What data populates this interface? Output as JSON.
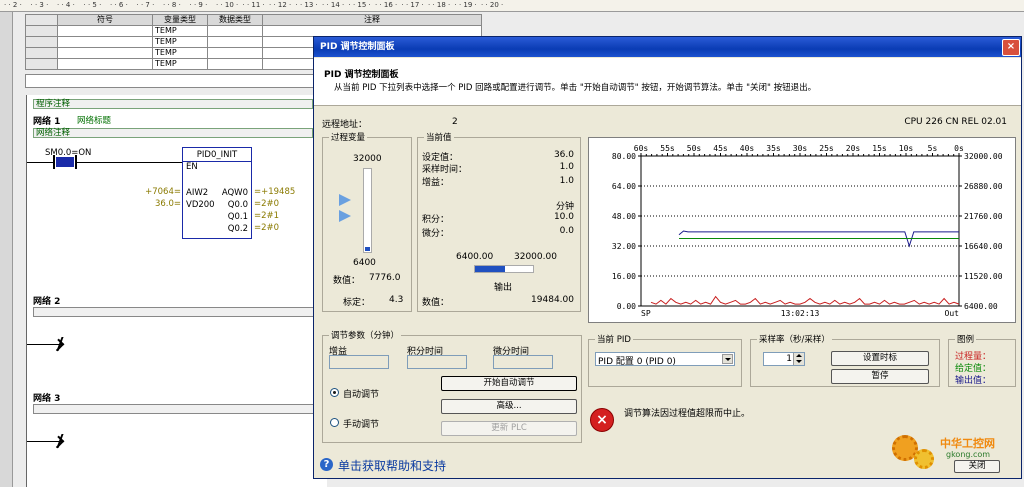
{
  "ruler": {
    "ticks": [
      "2",
      "3",
      "4",
      "5",
      "6",
      "7",
      "8",
      "9",
      "10",
      "11",
      "12",
      "13",
      "14",
      "15",
      "16",
      "17",
      "18",
      "19",
      "20"
    ]
  },
  "var_table": {
    "headers": [
      "符号",
      "变量类型",
      "数据类型",
      "注释"
    ],
    "rows": [
      [
        "TEMP"
      ],
      [
        "TEMP"
      ],
      [
        "TEMP"
      ],
      [
        "TEMP"
      ]
    ]
  },
  "ladder": {
    "program_comment": "程序注释",
    "net1_label": "网络 1",
    "net1_title": "网络标题",
    "net_comment": "网络注释",
    "contact": "SM0.0=ON",
    "block_name": "PID0_INIT",
    "block_en": "EN",
    "in_vals": [
      "+7064=",
      "36.0="
    ],
    "in_pins": [
      "AIW2",
      "VD200"
    ],
    "out_pins": [
      "AQW0",
      "Q0.0",
      "Q0.1",
      "Q0.2"
    ],
    "out_vals": [
      "=+19485",
      "=2#0",
      "=2#1",
      "=2#0"
    ],
    "net2_label": "网络 2",
    "net3_label": "网络 3"
  },
  "dialog": {
    "title": "PID 调节控制面板",
    "close": "×",
    "heading": "PID 调节控制面板",
    "description": "从当前 PID 下拉列表中选择一个 PID 回路或配置进行调节。单击 \"开始自动调节\" 按钮，开始调节算法。单击 \"关闭\" 按钮退出。",
    "remote_label": "远程地址：",
    "remote_value": "2",
    "cpu_info": "CPU 226 CN REL 02.01",
    "pv": {
      "title": "过程变量",
      "top": "32000",
      "bottom": "6400",
      "value_label": "数值：",
      "value": "7776.0",
      "calib_label": "标定：",
      "calib": "4.3",
      "level": 0.054
    },
    "current": {
      "title": "当前值",
      "setpoint_label": "设定值：",
      "setpoint": "36.0",
      "sample_label": "采样时间：",
      "sample": "1.0",
      "gain_label": "增益：",
      "gain": "1.0",
      "unit": "分钟",
      "integral_label": "积分：",
      "integral": "10.0",
      "derivative_label": "微分：",
      "derivative": "0.0",
      "out_min": "6400.00",
      "out_max": "32000.00",
      "output_label": "输出",
      "output_level": 0.51,
      "value_label": "数值：",
      "value": "19484.00"
    },
    "chart_data": {
      "type": "line",
      "x_top_ticks": [
        "60s",
        "55s",
        "50s",
        "45s",
        "40s",
        "35s",
        "30s",
        "25s",
        "20s",
        "15s",
        "10s",
        "5s",
        "0s"
      ],
      "left_ticks": [
        "80.00",
        "64.00",
        "48.00",
        "32.00",
        "16.00",
        "0.00"
      ],
      "right_ticks": [
        "32000.00",
        "26880.00",
        "21760.00",
        "16640.00",
        "11520.00",
        "6400.00"
      ],
      "ylim_left": [
        0,
        80
      ],
      "ylim_right": [
        6400,
        32000
      ],
      "bottom_left": "SP",
      "bottom_mid": "13:02:13",
      "bottom_right": "Out",
      "series": [
        {
          "color": "#1a1a8c",
          "values": [
            38,
            40,
            39.5,
            39.5,
            39.5,
            39.5,
            39.5,
            39.5,
            39.5,
            39.5,
            39.5,
            39.5,
            39.5,
            39.5,
            39.5,
            39.5,
            39.5,
            39.5,
            39.5,
            39.5,
            39.5,
            39.5,
            39.5,
            39.5,
            39.5,
            39.5,
            39.5,
            39.5,
            39.5,
            39.5,
            39.5,
            39.5,
            39.5,
            39.5,
            39.5,
            39.5,
            39.5,
            39.5,
            39.5,
            39.5,
            39.5,
            39.5,
            39.5,
            39.5,
            39.5,
            39.5,
            39.5,
            39.5,
            39.5,
            39.5,
            39.5,
            32,
            39.5,
            39.5,
            39.5,
            39.5,
            39.5,
            39.5,
            39.5,
            39.5,
            39.5,
            39.5,
            39.5
          ]
        },
        {
          "color": "#0a8a0a",
          "values": [
            36,
            36,
            36,
            36,
            36,
            36,
            36,
            36,
            36,
            36,
            36,
            36,
            36,
            36,
            36,
            36,
            36,
            36,
            36,
            36,
            36,
            36,
            36,
            36,
            36,
            36,
            36,
            36,
            36,
            36,
            36,
            36,
            36,
            36,
            36,
            36,
            36,
            36,
            36,
            36,
            36,
            36,
            36,
            36,
            36,
            36,
            36,
            36,
            36,
            36,
            36,
            36,
            36,
            36,
            36,
            36,
            36,
            36,
            36,
            36,
            36,
            36,
            36
          ]
        },
        {
          "color": "#c81e1e",
          "values": [
            2,
            1,
            3,
            1,
            4,
            2,
            1,
            2,
            1,
            3,
            1,
            2,
            1,
            5,
            2,
            1,
            2,
            3,
            1,
            1,
            2,
            4,
            1,
            2,
            1,
            2,
            3,
            1,
            2,
            1,
            1,
            2,
            4,
            2,
            1,
            2,
            1,
            3,
            1,
            2,
            1,
            2,
            4,
            1,
            1,
            2,
            1,
            3,
            1,
            2,
            1,
            1,
            2,
            3,
            1,
            2,
            1,
            2,
            1,
            4,
            1,
            2,
            1
          ]
        }
      ]
    },
    "params": {
      "title": "调节参数（分钟）",
      "gain": "增益",
      "integral": "积分时间",
      "derivative": "微分时间",
      "auto_label": "自动调节",
      "manual_label": "手动调节",
      "start_btn": "开始自动调节",
      "advanced_btn": "高级...",
      "update_btn": "更新 PLC"
    },
    "current_pid": {
      "title": "当前 PID",
      "selected": "PID 配置 0 (PID 0)"
    },
    "sample": {
      "title": "采样率（秒/采样）",
      "value": "1",
      "set_btn": "设置时标",
      "pause_btn": "暂停"
    },
    "legend": {
      "title": "图例",
      "pv": "过程量：",
      "sp": "给定值：",
      "out": "输出值：",
      "pv_color": "#c81e1e",
      "sp_color": "#0a8a0a",
      "out_color": "#1a1a8c"
    },
    "status_msg": "调节算法因过程值超限而中止。",
    "help": "单击获取帮助和支持",
    "close_btn": "关闭"
  },
  "watermark": {
    "text1": "中华工控网",
    "text2": "gkong.com"
  }
}
